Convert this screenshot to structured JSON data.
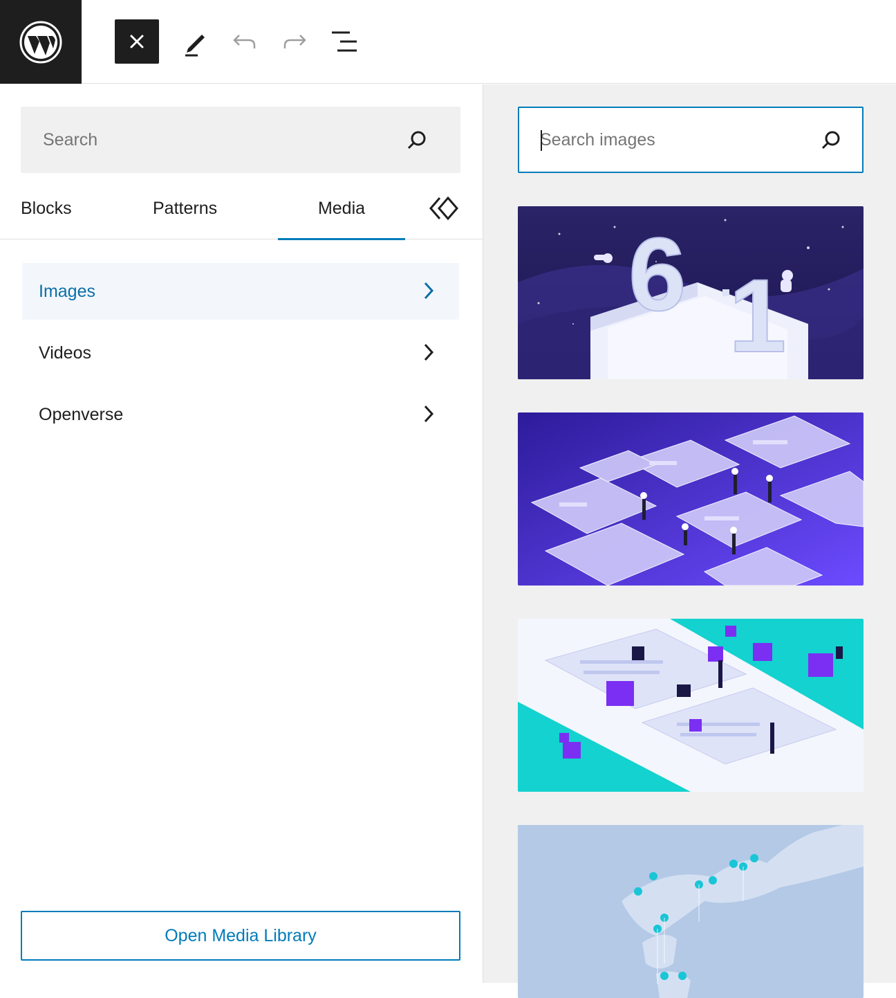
{
  "toolbar": {
    "logo": "wordpress-logo",
    "close_icon": "close-icon",
    "tools_icon": "pencil-icon",
    "undo_icon": "undo-icon",
    "redo_icon": "redo-icon",
    "list_view_icon": "list-view-icon"
  },
  "inserter": {
    "search": {
      "placeholder": "Search",
      "value": ""
    },
    "tabs": [
      {
        "label": "Blocks"
      },
      {
        "label": "Patterns"
      },
      {
        "label": "Media",
        "active": true
      },
      {
        "label": "",
        "icon": "reusable-block-icon"
      }
    ],
    "categories": [
      {
        "label": "Images",
        "active": true
      },
      {
        "label": "Videos"
      },
      {
        "label": "Openverse"
      }
    ],
    "open_media_library": "Open Media Library"
  },
  "media_panel": {
    "search": {
      "placeholder": "Search images",
      "value": ""
    },
    "images": [
      {
        "subject": "WordPress 6.1 isometric illustration with astronauts"
      },
      {
        "subject": "Isometric purple web pages with people"
      },
      {
        "subject": "Isometric cyan and purple blocks with people"
      },
      {
        "subject": "Map with location pins"
      }
    ]
  },
  "colors": {
    "accent": "#007cba",
    "dark": "#1e1e1e",
    "active_bg": "#f3f7fc",
    "panel_bg": "#f0f0f0"
  }
}
